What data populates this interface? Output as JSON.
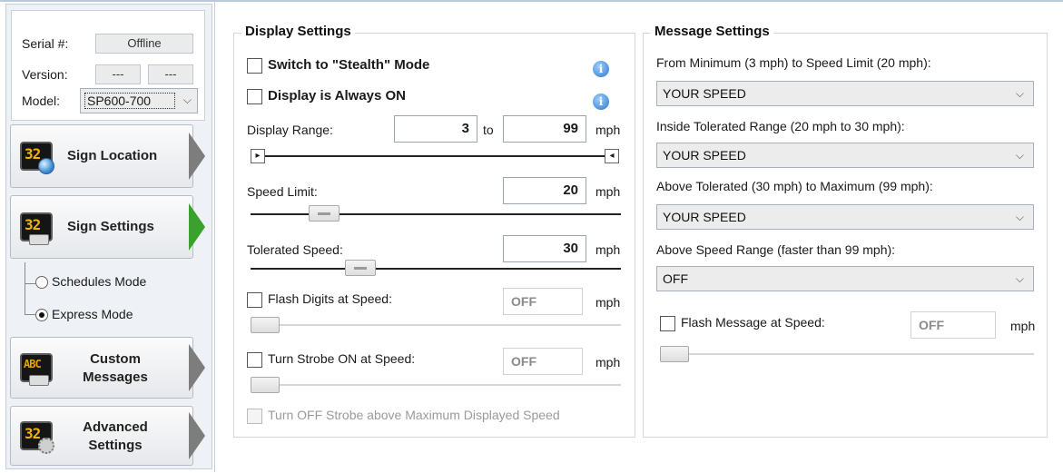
{
  "device": {
    "serial_label": "Serial #:",
    "serial_value": "Offline",
    "version_label": "Version:",
    "version_major": "---",
    "version_minor": "---",
    "model_label": "Model:",
    "model_value": "SP600-700"
  },
  "nav": {
    "sign_location": "Sign Location",
    "sign_settings": "Sign Settings",
    "custom_messages_1": "Custom",
    "custom_messages_2": "Messages",
    "advanced_settings_1": "Advanced",
    "advanced_settings_2": "Settings",
    "custom_icon_text": "ABC",
    "sign_icon_text": "32"
  },
  "modes": {
    "schedules": "Schedules Mode",
    "express": "Express Mode",
    "selected": "express"
  },
  "display_settings": {
    "title": "Display Settings",
    "stealth_label": "Switch to \"Stealth\" Mode",
    "always_on_label": "Display is Always ON",
    "range_label": "Display Range:",
    "range_min": "3",
    "range_to": "to",
    "range_max": "99",
    "unit": "mph",
    "speed_limit_label": "Speed Limit:",
    "speed_limit_value": "20",
    "tolerated_label": "Tolerated Speed:",
    "tolerated_value": "30",
    "flash_label": "Flash Digits at Speed:",
    "flash_value": "OFF",
    "strobe_label": "Turn Strobe ON at Speed:",
    "strobe_value": "OFF",
    "strobe_off_label": "Turn OFF Strobe above Maximum Displayed Speed"
  },
  "message_settings": {
    "title": "Message Settings",
    "min_to_limit_label": "From Minimum (3 mph) to Speed Limit (20 mph):",
    "min_to_limit_value": "YOUR SPEED",
    "inside_tolerated_label": "Inside Tolerated Range (20 mph to 30 mph):",
    "inside_tolerated_value": "YOUR SPEED",
    "above_tolerated_label": "Above Tolerated (30 mph) to Maximum (99 mph):",
    "above_tolerated_value": "YOUR SPEED",
    "above_range_label": "Above Speed Range (faster than 99 mph):",
    "above_range_value": "OFF",
    "flash_msg_label": "Flash Message at Speed:",
    "flash_msg_value": "OFF",
    "unit": "mph"
  },
  "icons": {
    "info": "i",
    "dropdown": "⌵",
    "left_end": "▸",
    "right_end": "◂"
  },
  "colors": {
    "active_arrow": "#3aa12f",
    "inactive_arrow": "#7d7d7d",
    "info_blue": "#2b76c8",
    "sign_digits": "#f5b400"
  }
}
